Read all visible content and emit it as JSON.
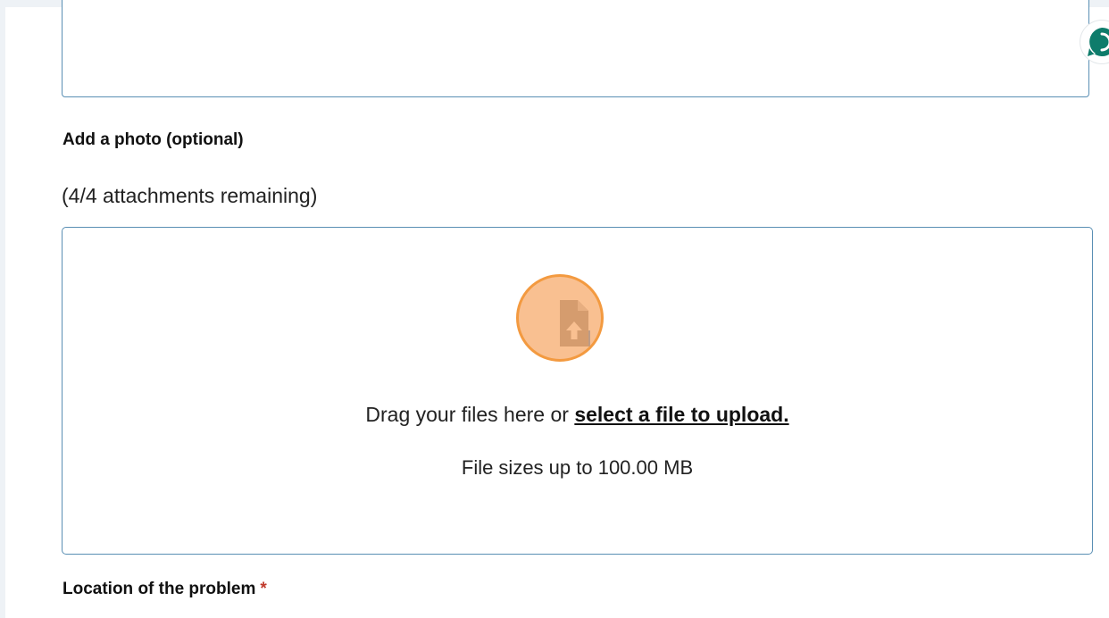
{
  "photo_section": {
    "label": "Add a photo (optional)",
    "attachments_remaining": "(4/4 attachments remaining)"
  },
  "dropzone": {
    "drag_text": "Drag your files here or",
    "select_link": "select a file to upload.",
    "size_limit": "File sizes up to 100.00 MB",
    "icon": "file-upload-icon"
  },
  "location_section": {
    "label": "Location of the problem",
    "required_marker": "*"
  },
  "icons": {
    "assistant": "chat-assistant-icon",
    "resize": "resize-handle-icon"
  },
  "colors": {
    "accent": "#0e7c6b",
    "field_border": "#5a8fb4",
    "required": "#c0392b",
    "click_marker": "#f39a40"
  }
}
